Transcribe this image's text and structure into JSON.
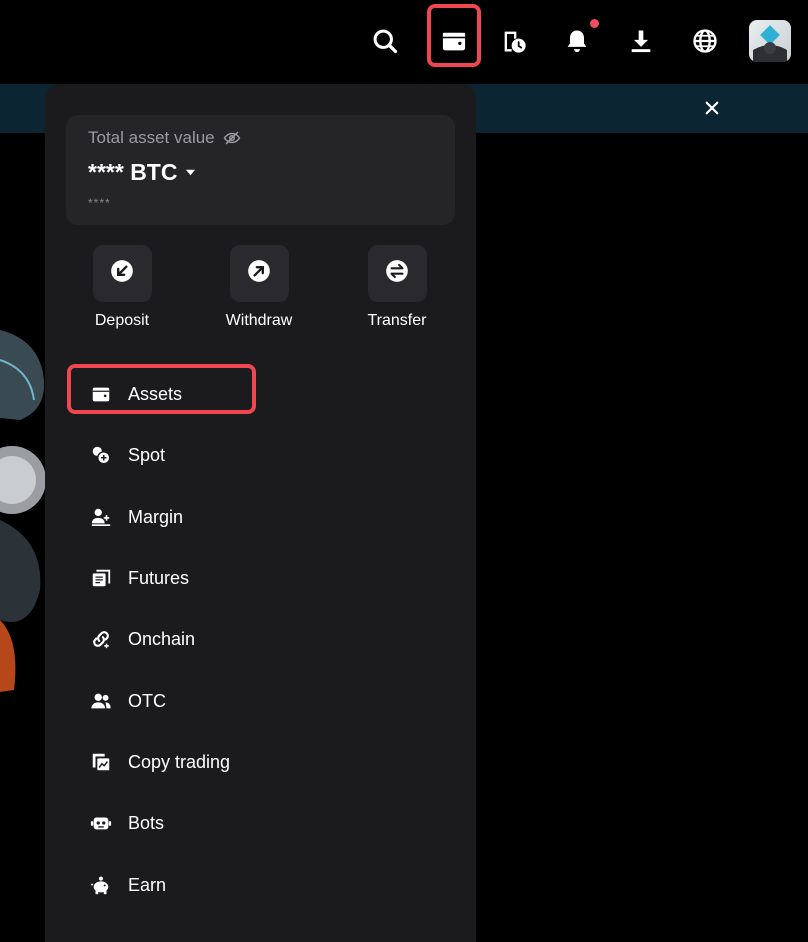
{
  "asset_card": {
    "label": "Total asset value",
    "value": "**** BTC",
    "sub_value": "****"
  },
  "actions": [
    {
      "label": "Deposit",
      "icon": "deposit-icon"
    },
    {
      "label": "Withdraw",
      "icon": "withdraw-icon"
    },
    {
      "label": "Transfer",
      "icon": "transfer-icon"
    }
  ],
  "menu": [
    {
      "label": "Assets",
      "icon": "wallet-icon"
    },
    {
      "label": "Spot",
      "icon": "spot-icon"
    },
    {
      "label": "Margin",
      "icon": "margin-icon"
    },
    {
      "label": "Futures",
      "icon": "futures-icon"
    },
    {
      "label": "Onchain",
      "icon": "link-icon"
    },
    {
      "label": "OTC",
      "icon": "users-icon"
    },
    {
      "label": "Copy trading",
      "icon": "copy-trading-icon"
    },
    {
      "label": "Bots",
      "icon": "robot-icon"
    },
    {
      "label": "Earn",
      "icon": "piggy-bank-icon"
    }
  ],
  "topbar_icons": [
    "search-icon",
    "wallet-icon",
    "history-icon",
    "bell-icon",
    "download-icon",
    "globe-icon",
    "avatar"
  ],
  "colors": {
    "highlight": "#ef4650",
    "panel_bg": "#1b1b1e",
    "card_bg": "#252528",
    "notification_dot": "#ef4e63",
    "banner_bg": "#0b2532"
  }
}
